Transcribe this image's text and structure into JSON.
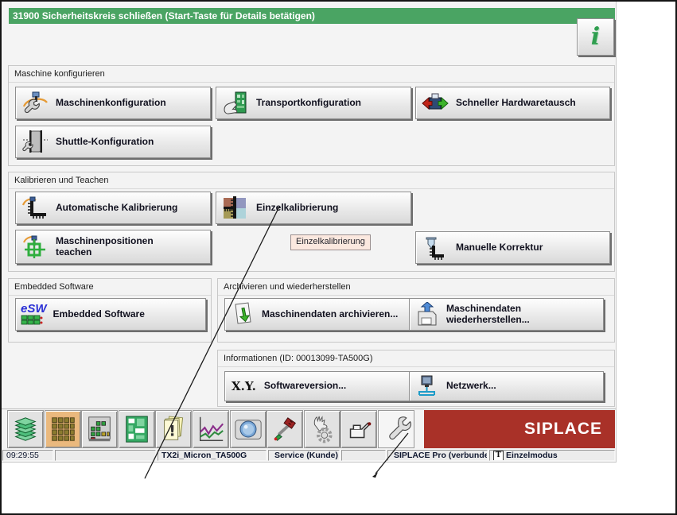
{
  "colors": {
    "title-green": "#4aa463",
    "brand-red": "#a93128",
    "selected-tan": "#eab97e",
    "tooltip-bg": "#fbe8df",
    "info-green": "#2f9e4f"
  },
  "window": {
    "title": "31900 Sicherheitskreis schließen (Start-Taste für Details betätigen)",
    "info_glyph": "i"
  },
  "sections": {
    "machine": {
      "label": "Maschine konfigurieren",
      "buttons": [
        {
          "label": "Maschinenkonfiguration",
          "icon": "machine-config-icon"
        },
        {
          "label": "Transportkonfiguration",
          "icon": "transport-config-icon"
        },
        {
          "label": "Schneller Hardwaretausch",
          "icon": "hardware-swap-icon"
        },
        {
          "label": "Shuttle-Konfiguration",
          "icon": "shuttle-config-icon"
        }
      ]
    },
    "calibration": {
      "label": "Kalibrieren und Teachen",
      "buttons": [
        {
          "label": "Automatische Kalibrierung",
          "icon": "auto-calibration-icon"
        },
        {
          "label": "Einzelkalibrierung",
          "icon": "single-calibration-icon"
        },
        {
          "label": "Maschinenpositionen\nteachen",
          "icon": "teach-positions-icon"
        },
        {
          "label": "Manuelle Korrektur",
          "icon": "manual-correction-icon"
        }
      ]
    },
    "embedded": {
      "label": "Embedded Software",
      "buttons": [
        {
          "label": "Embedded Software",
          "icon": "esw-icon",
          "icon_text": "eSW"
        }
      ]
    },
    "archive": {
      "label": "Archivieren und wiederherstellen",
      "buttons": [
        {
          "label": "Maschinendaten archivieren...",
          "icon": "archive-icon"
        },
        {
          "label": "Maschinendaten wiederherstellen...",
          "icon": "restore-icon"
        }
      ]
    },
    "information": {
      "label": "Informationen (ID: 00013099-TA500G)",
      "buttons": [
        {
          "label": "Softwareversion...",
          "icon": "software-version-icon",
          "icon_text": "X.Y."
        },
        {
          "label": "Netzwerk...",
          "icon": "network-icon"
        }
      ]
    }
  },
  "tooltip": {
    "text": "Einzelkalibrierung"
  },
  "toolbar": {
    "brand": "SIPLACE",
    "selected": "matrix",
    "active": "wrench",
    "items": [
      {
        "icon": "boards-stack-icon"
      },
      {
        "icon": "matrix-icon"
      },
      {
        "icon": "component-levels-icon"
      },
      {
        "icon": "pcb-layout-icon"
      },
      {
        "icon": "messages-icon"
      },
      {
        "icon": "trend-chart-icon"
      },
      {
        "icon": "camera-icon"
      },
      {
        "icon": "screwdriver-icon"
      },
      {
        "icon": "hand-gear-icon"
      },
      {
        "icon": "oil-can-icon"
      },
      {
        "icon": "wrench-icon"
      }
    ]
  },
  "statusbar": {
    "time": "09:29:55",
    "machine": "TX2i_Micron_TA500G",
    "user": "Service (Kunde)",
    "connection": "SIPLACE Pro (verbunden)",
    "mode": "Einzelmodus",
    "mode_glyph": "T"
  }
}
